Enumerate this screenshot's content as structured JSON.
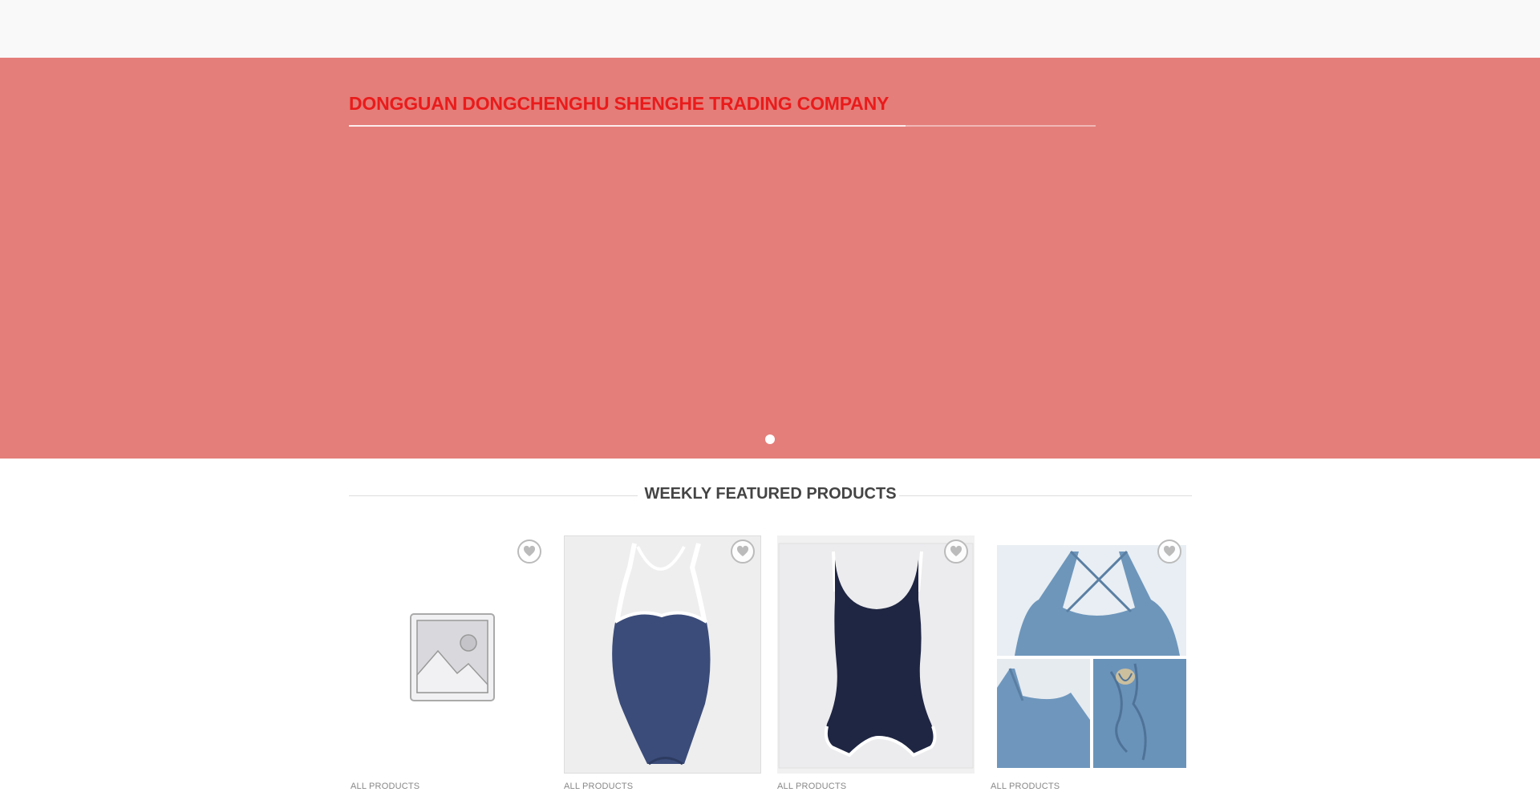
{
  "hero": {
    "title": "DONGGUAN DONGCHENGHU SHENGHE TRADING COMPANY",
    "background_color": "#e47e7a",
    "title_color": "#ea1b1b"
  },
  "section": {
    "title": "WEEKLY FEATURED PRODUCTS"
  },
  "products": [
    {
      "image": "placeholder-image",
      "category": "ALL PRODUCTS"
    },
    {
      "image": "navy-swimsuit-photo",
      "category": "ALL PRODUCTS"
    },
    {
      "image": "dark-navy-swimsuit-photo",
      "category": "ALL PRODUCTS"
    },
    {
      "image": "blue-swimsuit-collage",
      "category": "ALL PRODUCTS"
    }
  ],
  "icons": {
    "wishlist": "heart-icon",
    "slider_dot": "dot-icon"
  }
}
